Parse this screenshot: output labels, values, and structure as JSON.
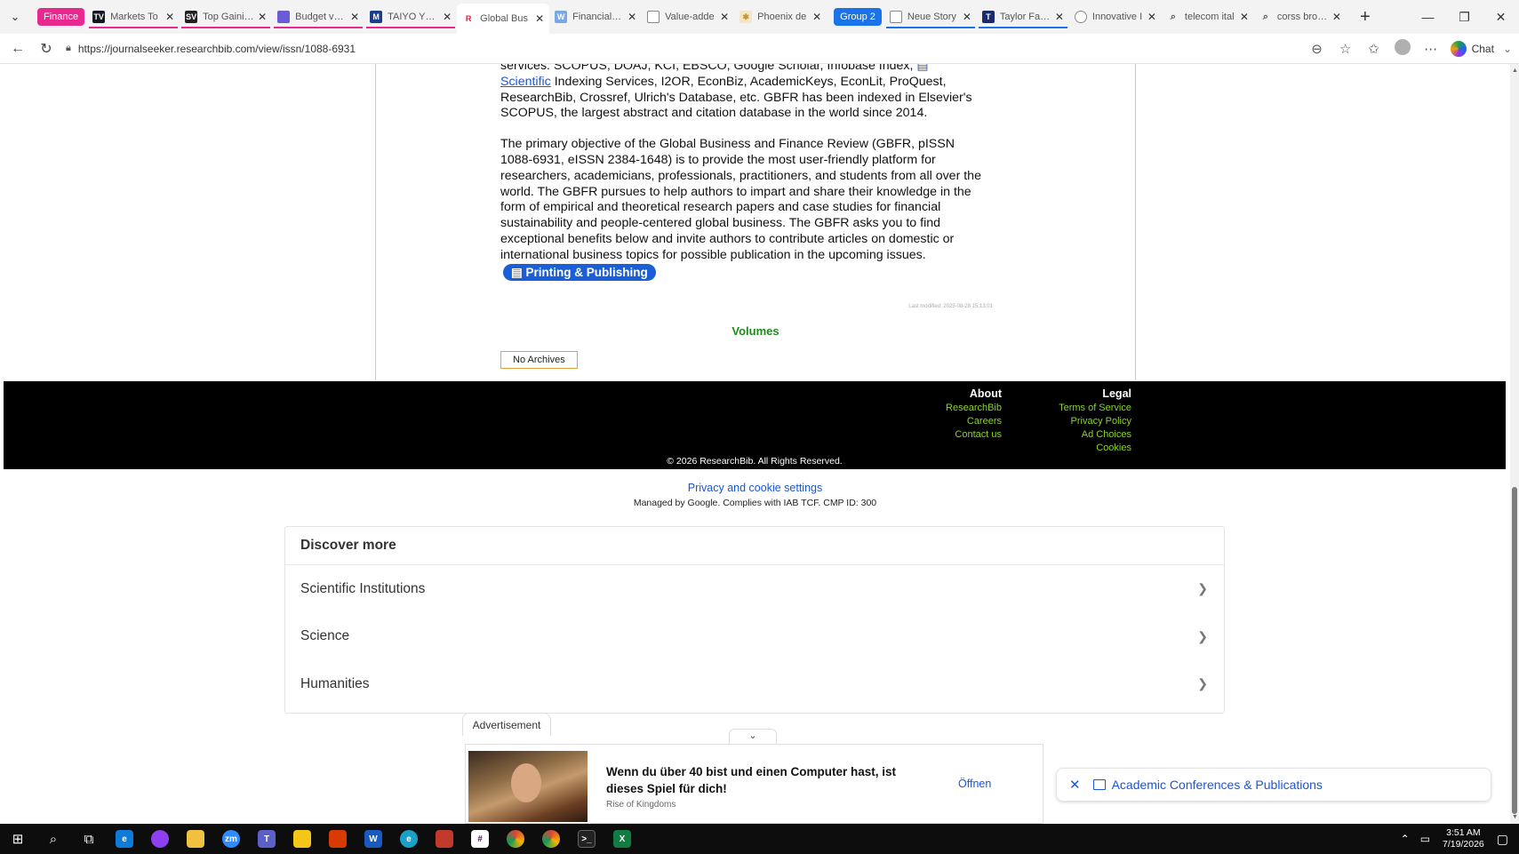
{
  "browser": {
    "tab_groups": [
      {
        "label": "Finance",
        "color": "#e8288f"
      },
      {
        "label": "Group 2",
        "color": "#1a73e8"
      }
    ],
    "tabs": [
      {
        "title": "Markets To",
        "favicon": "TV",
        "fav_color": "#131722"
      },
      {
        "title": "Top Gaining",
        "favicon": "SV",
        "fav_color": "#222222"
      },
      {
        "title": "Budget vs. I",
        "favicon": "doc",
        "fav_color": "#6b5bd6"
      },
      {
        "title": "TAIYO YUDE",
        "favicon": "M",
        "fav_color": "#1a3e8a"
      },
      {
        "title": "Global Bus",
        "favicon": "R",
        "fav_color": "#ffffff"
      },
      {
        "title": "Financial Re",
        "favicon": "W",
        "fav_color": "#7aa7e6"
      },
      {
        "title": "Value-adde",
        "favicon": "doc",
        "fav_color": "#888888"
      },
      {
        "title": "Phoenix de",
        "favicon": "*",
        "fav_color": "#e0b060"
      },
      {
        "title": "Neue Story",
        "favicon": "doc",
        "fav_color": "#888888"
      },
      {
        "title": "Taylor Farm",
        "favicon": "T",
        "fav_color": "#1a2a6a"
      },
      {
        "title": "Innovative I",
        "favicon": "globe",
        "fav_color": "#888888"
      },
      {
        "title": "telecom ital",
        "favicon": "search",
        "fav_color": "#888888"
      },
      {
        "title": "corss brows",
        "favicon": "search",
        "fav_color": "#888888"
      }
    ],
    "url": "https://journalseeker.researchbib.com/view/issn/1088-6931",
    "chat_label": "Chat"
  },
  "content": {
    "para1_a": "services: SCOPUS, DOAJ, KCI, EBSCO, Google Scholar, Infobase Index, ",
    "para1_link": "Scientific",
    "para1_b": " Indexing Services, I2OR, EconBiz, AcademicKeys, EconLit, ProQuest, ResearchBib, Crossref, Ulrich's Database, etc. GBFR has been indexed in Elsevier's SCOPUS, the largest abstract and citation database in the world since 2014.",
    "para2": "The primary objective of the Global Business and Finance Review (GBFR, pISSN 1088-6931, eISSN 2384-1648) is to provide the most user-friendly platform for researchers, academicians, professionals, practitioners, and students from all over the world. The GBFR pursues to help authors to impart and share their knowledge in the form of empirical and theoretical research papers and case studies for financial sustainability and people-centered global business. The GBFR asks you to find exceptional benefits below and invite authors to contribute articles on domestic or international business topics for possible publication in the upcoming issues.",
    "printing_btn": "Printing & Publishing",
    "last_modified": "Last modified: 2025-08-28 15:13:01",
    "volumes": "Volumes",
    "no_archives": "No Archives"
  },
  "footer": {
    "about_heading": "About",
    "about_links": [
      "ResearchBib",
      "Careers",
      "Contact us"
    ],
    "legal_heading": "Legal",
    "legal_links": [
      "Terms of Service",
      "Privacy Policy",
      "Ad Choices",
      "Cookies"
    ],
    "copyright": "© 2026 ResearchBib. All Rights Reserved."
  },
  "privacy": {
    "link": "Privacy and cookie settings",
    "managed": "Managed by Google. Complies with IAB TCF. CMP ID: 300"
  },
  "discover": {
    "title": "Discover more",
    "items": [
      "Scientific Institutions",
      "Science",
      "Humanities"
    ]
  },
  "ad": {
    "tab_label": "Advertisement",
    "headline": "Wenn du über 40 bist und einen Computer hast, ist dieses Spiel für dich!",
    "source": "Rise of Kingdoms",
    "open_label": "Öffnen"
  },
  "conference_pill": {
    "label": "Academic Conferences & Publications"
  },
  "taskbar": {
    "time": "3:51 AM",
    "date": "7/19/2026"
  }
}
